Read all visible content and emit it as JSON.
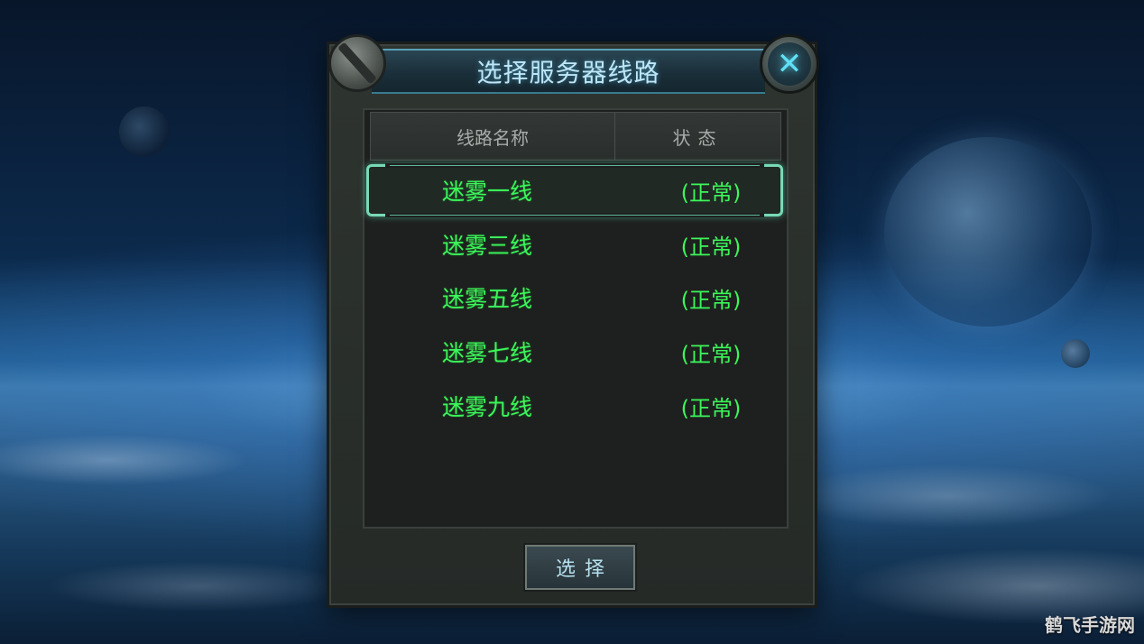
{
  "dialog": {
    "title": "选择服务器线路",
    "close_symbol": "✕"
  },
  "table": {
    "headers": {
      "name": "线路名称",
      "status": "状态"
    },
    "rows": [
      {
        "name": "迷雾一线",
        "status": "(正常)",
        "selected": true
      },
      {
        "name": "迷雾三线",
        "status": "(正常)",
        "selected": false
      },
      {
        "name": "迷雾五线",
        "status": "(正常)",
        "selected": false
      },
      {
        "name": "迷雾七线",
        "status": "(正常)",
        "selected": false
      },
      {
        "name": "迷雾九线",
        "status": "(正常)",
        "selected": false
      }
    ]
  },
  "actions": {
    "select_label": "选择"
  },
  "watermark": "鹤飞手游网",
  "colors": {
    "row_text": "#3cf55a",
    "title_text": "#bfe6f6",
    "accent": "#5fe0f4"
  }
}
